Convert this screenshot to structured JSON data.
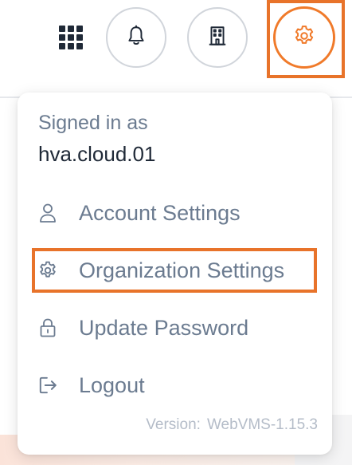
{
  "header": {
    "apps_icon": "grid-icon",
    "notifications_icon": "bell-icon",
    "organization_icon": "building-icon",
    "settings_icon": "gear-icon",
    "accent_color": "#f07a2a"
  },
  "dropdown": {
    "signed_in_label": "Signed in as",
    "username": "hva.cloud.01",
    "items": [
      {
        "label": "Account Settings",
        "icon": "user-icon"
      },
      {
        "label": "Organization Settings",
        "icon": "gear-icon"
      },
      {
        "label": "Update Password",
        "icon": "lock-icon"
      },
      {
        "label": "Logout",
        "icon": "logout-icon"
      }
    ],
    "version_label": "Version:",
    "version_value": "WebVMS-1.15.3"
  },
  "highlight_color": "#e8732a"
}
